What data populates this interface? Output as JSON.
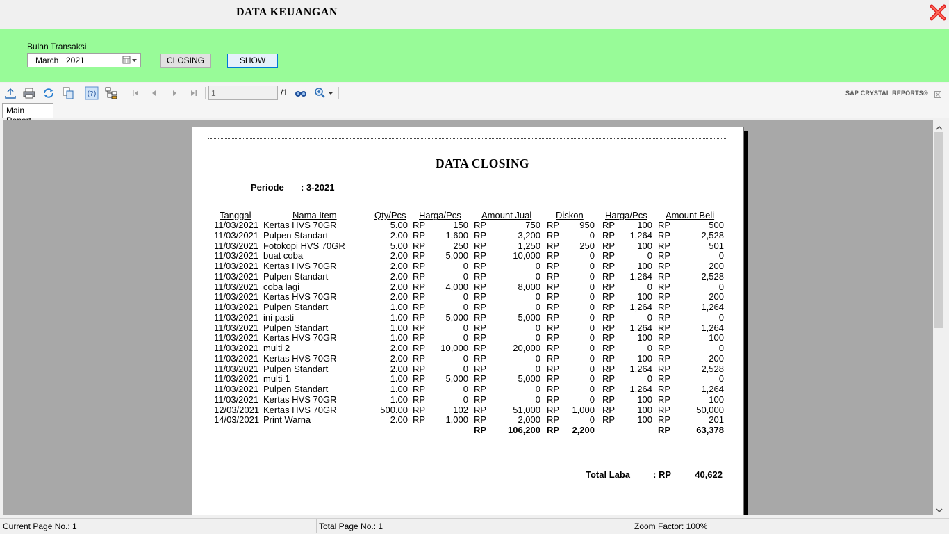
{
  "window": {
    "title": "DATA KEUANGAN",
    "close_icon": "close-icon"
  },
  "filter": {
    "label": "Bulan Transaksi",
    "month": "March",
    "year": "2021",
    "closing_label": "CLOSING",
    "show_label": "SHOW",
    "panel_color": "#98fb98"
  },
  "toolbar": {
    "icons": [
      "export-icon",
      "print-icon",
      "refresh-icon",
      "copy-icon",
      "help-icon",
      "group-tree-icon",
      "first-page-icon",
      "prev-page-icon",
      "next-page-icon",
      "last-page-icon",
      "find-icon",
      "zoom-icon"
    ],
    "page_value": "1",
    "page_total": "/1",
    "brand": "SAP CRYSTAL REPORTS®"
  },
  "tabs": [
    {
      "label": "Main Report"
    }
  ],
  "report": {
    "title": "DATA CLOSING",
    "periode_label": "Periode",
    "periode_value": ": 3-2021",
    "headers": {
      "tanggal": "Tanggal",
      "nama_item": "Nama Item",
      "qty": "Qty/Pcs",
      "harga_jual": "Harga/Pcs",
      "amount_jual": "Amount Jual",
      "diskon": "Diskon",
      "harga_beli": "Harga/Pcs",
      "amount_beli": "Amount Beli"
    },
    "currency": "RP",
    "rows": [
      {
        "tanggal": "11/03/2021",
        "item": "Kertas HVS 70GR",
        "qty": "5.00",
        "harga_jual": "150",
        "amount_jual": "750",
        "diskon": "950",
        "harga_beli": "100",
        "amount_beli": "500"
      },
      {
        "tanggal": "11/03/2021",
        "item": "Pulpen Standart",
        "qty": "2.00",
        "harga_jual": "1,600",
        "amount_jual": "3,200",
        "diskon": "0",
        "harga_beli": "1,264",
        "amount_beli": "2,528"
      },
      {
        "tanggal": "11/03/2021",
        "item": "Fotokopi HVS 70GR",
        "qty": "5.00",
        "harga_jual": "250",
        "amount_jual": "1,250",
        "diskon": "250",
        "harga_beli": "100",
        "amount_beli": "501"
      },
      {
        "tanggal": "11/03/2021",
        "item": "buat coba",
        "qty": "2.00",
        "harga_jual": "5,000",
        "amount_jual": "10,000",
        "diskon": "0",
        "harga_beli": "0",
        "amount_beli": "0"
      },
      {
        "tanggal": "11/03/2021",
        "item": "Kertas HVS 70GR",
        "qty": "2.00",
        "harga_jual": "0",
        "amount_jual": "0",
        "diskon": "0",
        "harga_beli": "100",
        "amount_beli": "200"
      },
      {
        "tanggal": "11/03/2021",
        "item": "Pulpen Standart",
        "qty": "2.00",
        "harga_jual": "0",
        "amount_jual": "0",
        "diskon": "0",
        "harga_beli": "1,264",
        "amount_beli": "2,528"
      },
      {
        "tanggal": "11/03/2021",
        "item": "coba lagi",
        "qty": "2.00",
        "harga_jual": "4,000",
        "amount_jual": "8,000",
        "diskon": "0",
        "harga_beli": "0",
        "amount_beli": "0"
      },
      {
        "tanggal": "11/03/2021",
        "item": "Kertas HVS 70GR",
        "qty": "2.00",
        "harga_jual": "0",
        "amount_jual": "0",
        "diskon": "0",
        "harga_beli": "100",
        "amount_beli": "200"
      },
      {
        "tanggal": "11/03/2021",
        "item": "Pulpen Standart",
        "qty": "1.00",
        "harga_jual": "0",
        "amount_jual": "0",
        "diskon": "0",
        "harga_beli": "1,264",
        "amount_beli": "1,264"
      },
      {
        "tanggal": "11/03/2021",
        "item": "ini pasti",
        "qty": "1.00",
        "harga_jual": "5,000",
        "amount_jual": "5,000",
        "diskon": "0",
        "harga_beli": "0",
        "amount_beli": "0"
      },
      {
        "tanggal": "11/03/2021",
        "item": "Pulpen Standart",
        "qty": "1.00",
        "harga_jual": "0",
        "amount_jual": "0",
        "diskon": "0",
        "harga_beli": "1,264",
        "amount_beli": "1,264"
      },
      {
        "tanggal": "11/03/2021",
        "item": "Kertas HVS 70GR",
        "qty": "1.00",
        "harga_jual": "0",
        "amount_jual": "0",
        "diskon": "0",
        "harga_beli": "100",
        "amount_beli": "100"
      },
      {
        "tanggal": "11/03/2021",
        "item": "multi 2",
        "qty": "2.00",
        "harga_jual": "10,000",
        "amount_jual": "20,000",
        "diskon": "0",
        "harga_beli": "0",
        "amount_beli": "0"
      },
      {
        "tanggal": "11/03/2021",
        "item": "Kertas HVS 70GR",
        "qty": "2.00",
        "harga_jual": "0",
        "amount_jual": "0",
        "diskon": "0",
        "harga_beli": "100",
        "amount_beli": "200"
      },
      {
        "tanggal": "11/03/2021",
        "item": "Pulpen Standart",
        "qty": "2.00",
        "harga_jual": "0",
        "amount_jual": "0",
        "diskon": "0",
        "harga_beli": "1,264",
        "amount_beli": "2,528"
      },
      {
        "tanggal": "11/03/2021",
        "item": "multi 1",
        "qty": "1.00",
        "harga_jual": "5,000",
        "amount_jual": "5,000",
        "diskon": "0",
        "harga_beli": "0",
        "amount_beli": "0"
      },
      {
        "tanggal": "11/03/2021",
        "item": "Pulpen Standart",
        "qty": "1.00",
        "harga_jual": "0",
        "amount_jual": "0",
        "diskon": "0",
        "harga_beli": "1,264",
        "amount_beli": "1,264"
      },
      {
        "tanggal": "11/03/2021",
        "item": "Kertas HVS 70GR",
        "qty": "1.00",
        "harga_jual": "0",
        "amount_jual": "0",
        "diskon": "0",
        "harga_beli": "100",
        "amount_beli": "100"
      },
      {
        "tanggal": "12/03/2021",
        "item": "Kertas HVS 70GR",
        "qty": "500.00",
        "harga_jual": "102",
        "amount_jual": "51,000",
        "diskon": "1,000",
        "harga_beli": "100",
        "amount_beli": "50,000"
      },
      {
        "tanggal": "14/03/2021",
        "item": "Print Warna",
        "qty": "2.00",
        "harga_jual": "1,000",
        "amount_jual": "2,000",
        "diskon": "0",
        "harga_beli": "100",
        "amount_beli": "201"
      }
    ],
    "totals": {
      "amount_jual": "106,200",
      "diskon": "2,200",
      "amount_beli": "63,378"
    },
    "laba_label": "Total Laba",
    "laba_rp": ": RP",
    "laba_value": "40,622"
  },
  "status": {
    "current_page": "Current Page No.: 1",
    "total_page": "Total Page No.: 1",
    "zoom": "Zoom Factor: 100%"
  }
}
